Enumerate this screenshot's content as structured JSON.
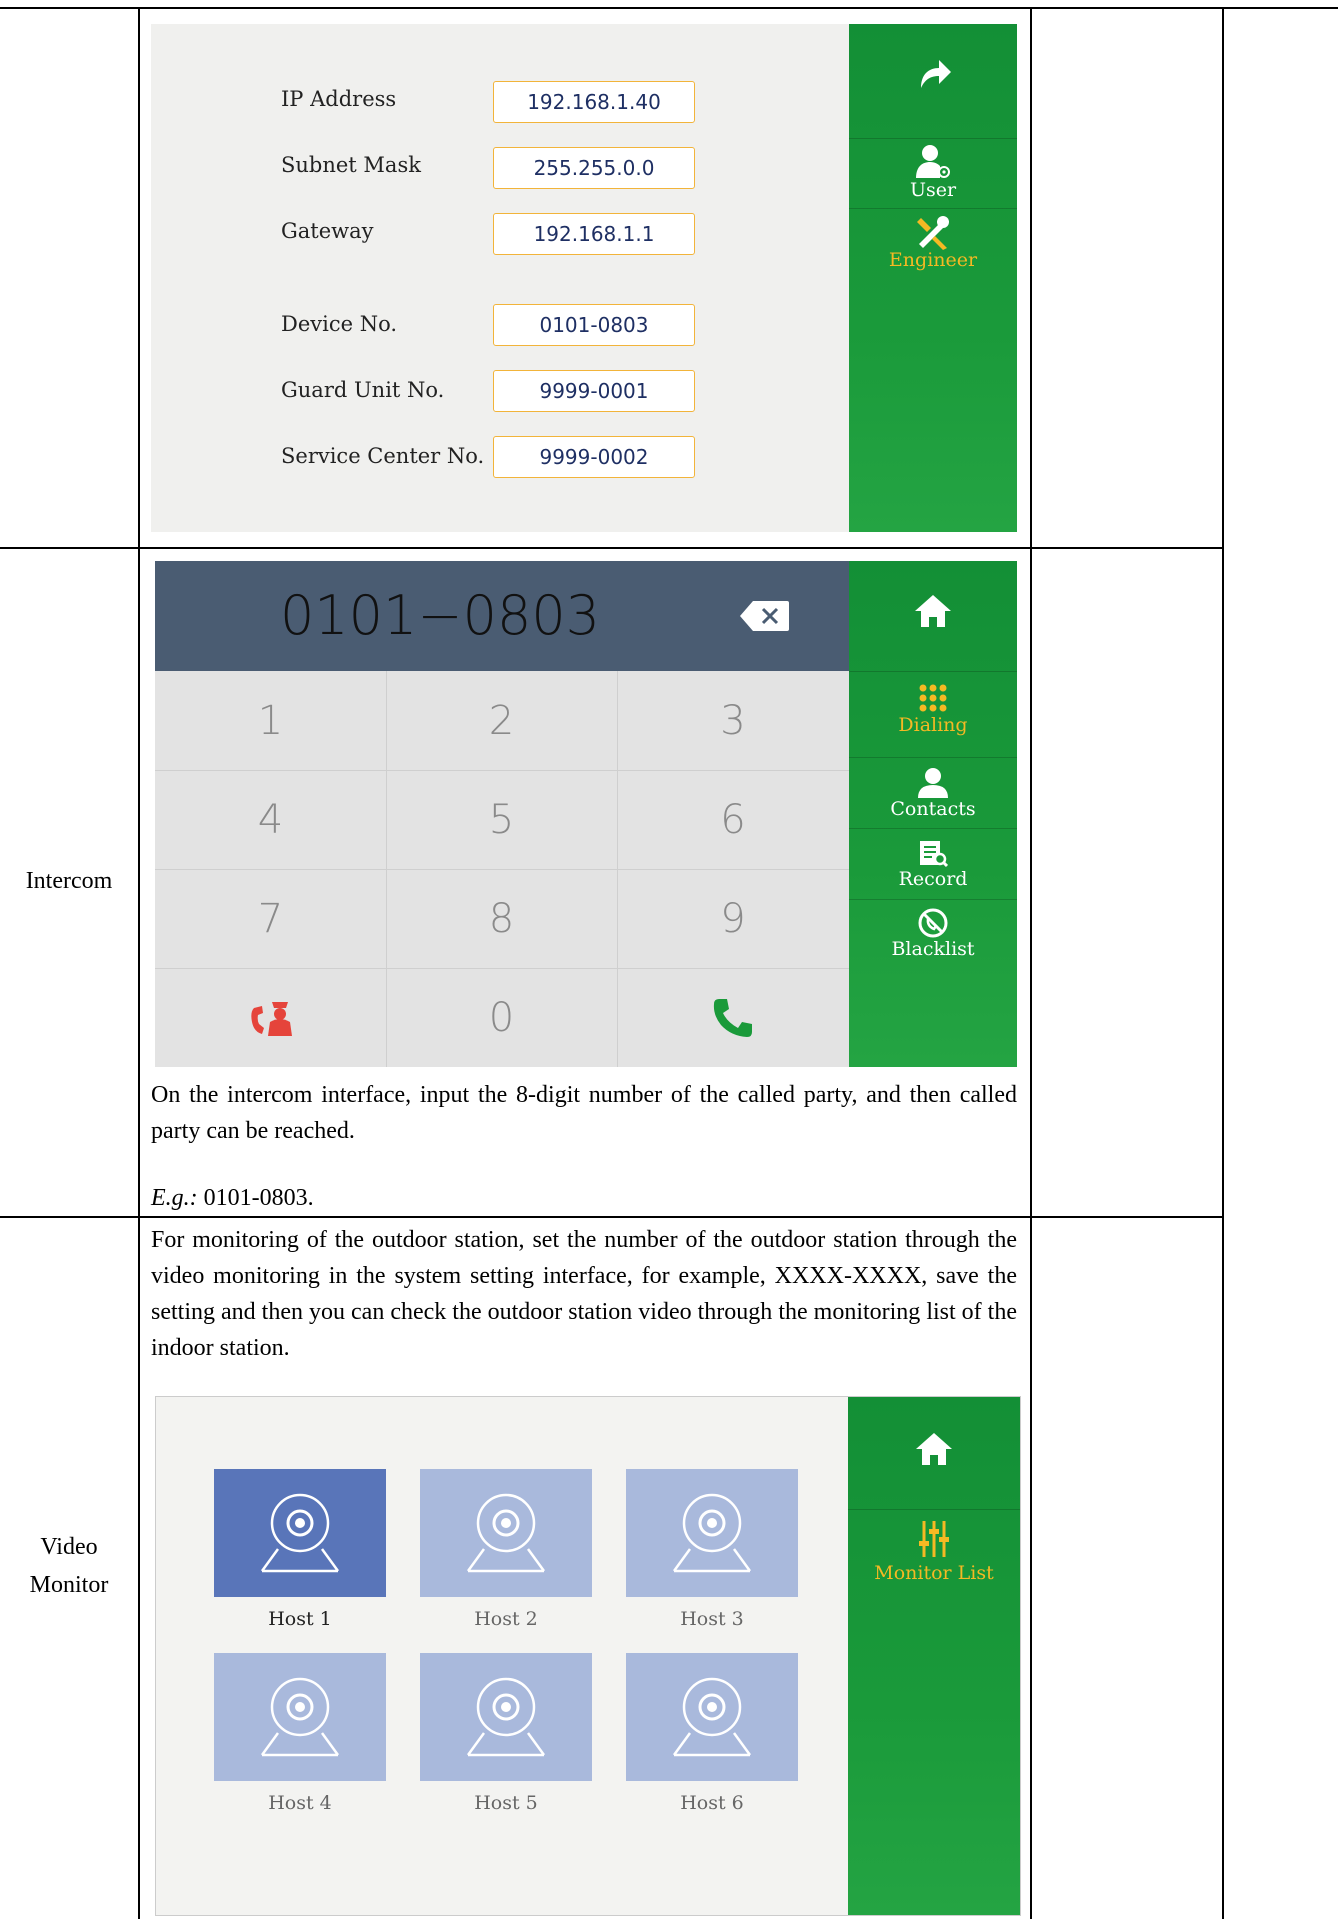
{
  "network_screen": {
    "fields": [
      {
        "label": "IP Address",
        "value": "192.168.1.40"
      },
      {
        "label": "Subnet Mask",
        "value": "255.255.0.0"
      },
      {
        "label": "Gateway",
        "value": "192.168.1.1"
      },
      {
        "label": "Device No.",
        "value": "0101-0803"
      },
      {
        "label": "Guard Unit No.",
        "value": "9999-0001"
      },
      {
        "label": "Service Center No.",
        "value": "9999-0002"
      }
    ],
    "sidebar": {
      "back_icon": "forward-arrow-icon",
      "items": [
        {
          "label": "User",
          "icon": "user-settings-icon"
        },
        {
          "label": "Engineer",
          "icon": "tools-icon",
          "active": true
        }
      ]
    }
  },
  "intercom_row": {
    "label": "Intercom",
    "display_number": "0101−0803",
    "keys": [
      "1",
      "2",
      "3",
      "4",
      "5",
      "6",
      "7",
      "8",
      "9",
      "0"
    ],
    "sidebar": {
      "items": [
        {
          "label": "Dialing",
          "icon": "keypad-icon",
          "active": true
        },
        {
          "label": "Contacts",
          "icon": "person-icon"
        },
        {
          "label": "Record",
          "icon": "record-icon"
        },
        {
          "label": "Blacklist",
          "icon": "blocked-icon"
        }
      ]
    },
    "description": "On the intercom interface, input the 8-digit number of the called party, and then called party can be reached.",
    "example_label": "E.g.:",
    "example_value": " 0101-0803."
  },
  "video_monitor_row": {
    "label_line1": "Video",
    "label_line2": "Monitor",
    "description": "For monitoring of the outdoor station, set the number of the outdoor station through the video monitoring in the system setting interface, for example, XXXX-XXXX, save the setting and then you can check the outdoor station video through the monitoring list of the indoor station.",
    "hosts": [
      "Host 1",
      "Host 2",
      "Host 3",
      "Host 4",
      "Host 5",
      "Host 6"
    ],
    "sidebar": {
      "items": [
        {
          "label": "Monitor List",
          "icon": "sliders-icon",
          "active": true
        }
      ]
    }
  },
  "colors": {
    "sidebar_green": "#1a9a3a",
    "active_yellow": "#f5b923",
    "dial_header": "#4a5c72",
    "tile_selected": "#5975b9",
    "tile_normal": "#a9b9dc"
  }
}
